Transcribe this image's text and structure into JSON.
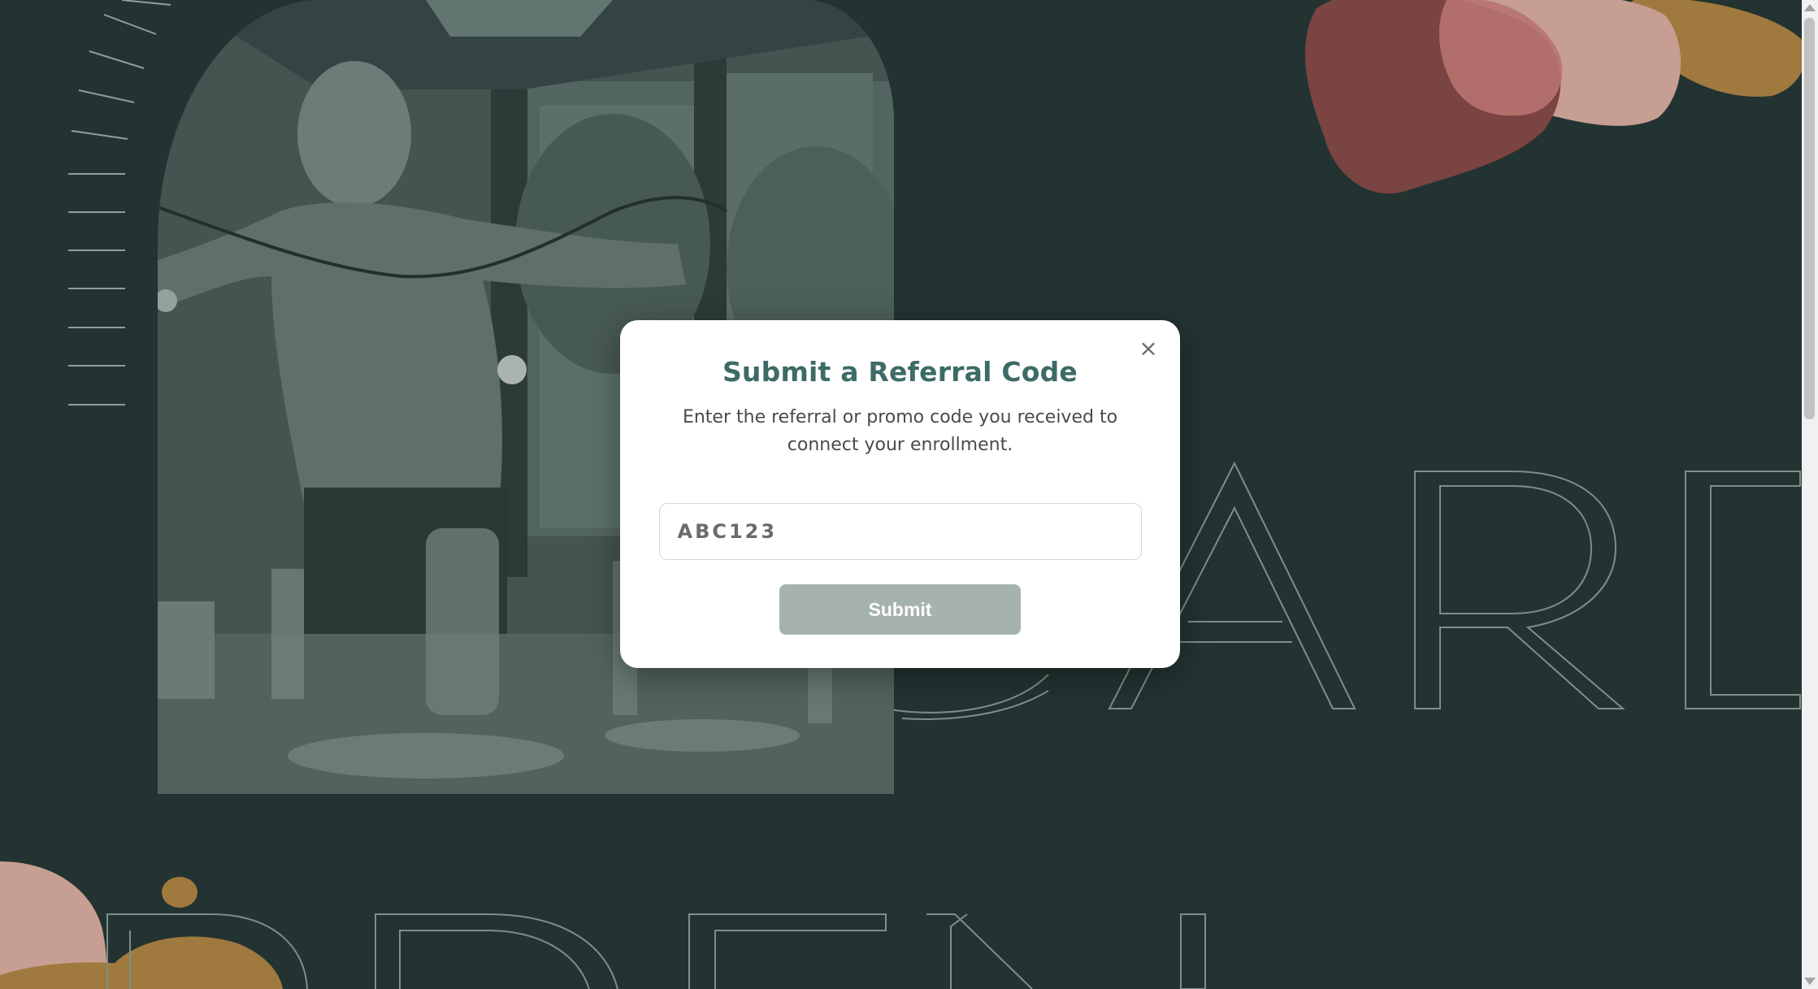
{
  "background": {
    "color": "#233331",
    "outline_word_right": "GARD",
    "outline_word_bottom": "RDEN",
    "photo_subject": "man-stringing-lights-photo"
  },
  "modal": {
    "close_symbol": "×",
    "title": "Submit a Referral Code",
    "description": "Enter the referral or promo code you received to connect your enrollment.",
    "input_placeholder": "ABC123",
    "input_value": "",
    "submit_label": "Submit"
  },
  "colors": {
    "accent_title": "#3d6b66",
    "button_disabled": "#a6b2b0",
    "blob_red": "#7a4443",
    "blob_pink": "#b77370",
    "blob_beige": "#c79f92",
    "blob_gold": "#a0793f"
  },
  "icons": {
    "close": "close-icon"
  }
}
